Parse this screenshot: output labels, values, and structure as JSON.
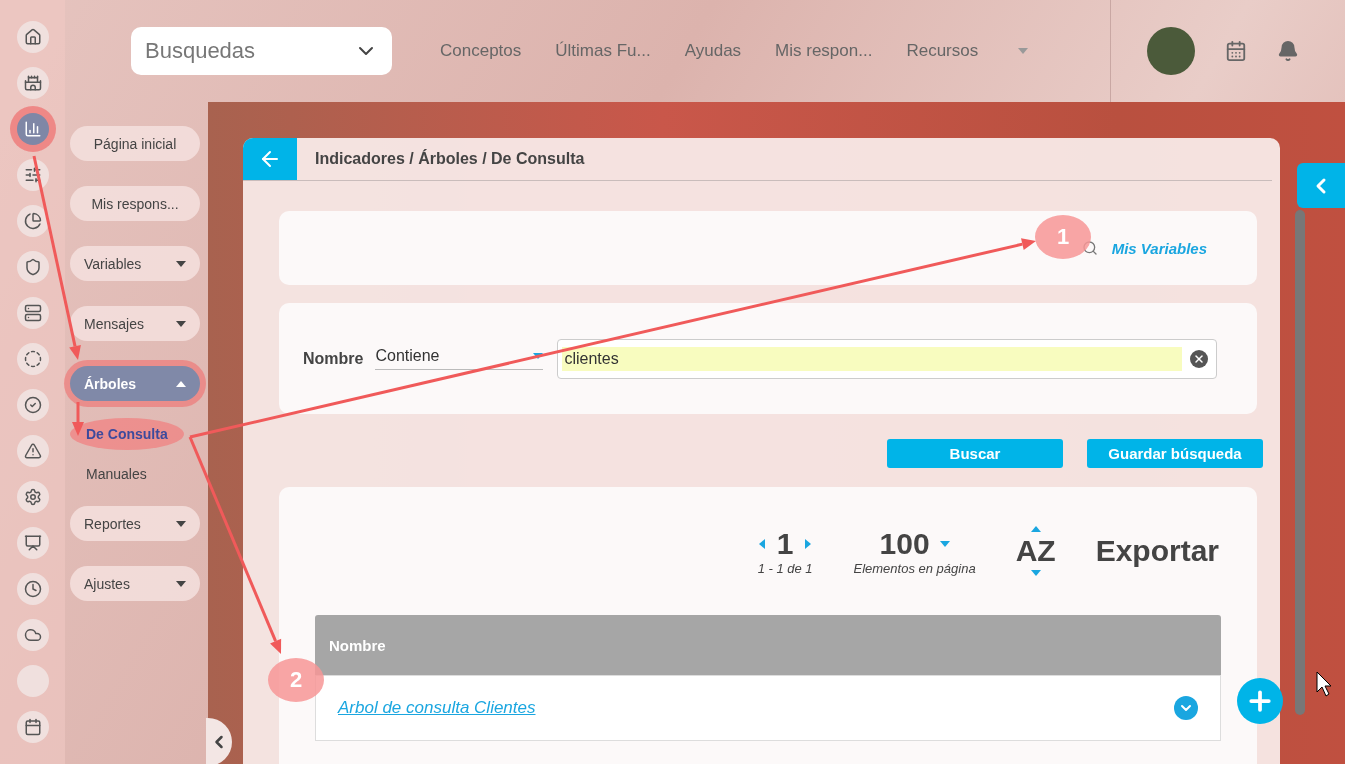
{
  "rail": [
    {
      "kind": "home",
      "selected": false
    },
    {
      "kind": "rook",
      "selected": false
    },
    {
      "kind": "chart",
      "selected": true
    },
    {
      "kind": "filter",
      "selected": false
    },
    {
      "kind": "pie",
      "selected": false
    },
    {
      "kind": "shield",
      "selected": false
    },
    {
      "kind": "list",
      "selected": false
    },
    {
      "kind": "cycle",
      "selected": false
    },
    {
      "kind": "check",
      "selected": false
    },
    {
      "kind": "alert",
      "selected": false
    },
    {
      "kind": "gears",
      "selected": false
    },
    {
      "kind": "board",
      "selected": false
    },
    {
      "kind": "clock",
      "selected": false
    },
    {
      "kind": "cloud",
      "selected": false
    },
    {
      "kind": "blank",
      "selected": false
    },
    {
      "kind": "calendar",
      "selected": false
    }
  ],
  "topbar": {
    "dropdown": "Busquedas",
    "nav": [
      "Conceptos",
      "Últimas Fu...",
      "Ayudas",
      "Mis respon...",
      "Recursos"
    ]
  },
  "menu": [
    {
      "label": "Página inicial",
      "expandable": false,
      "selected": false
    },
    {
      "label": "Mis respons...",
      "expandable": false,
      "selected": false
    },
    {
      "label": "Variables",
      "expandable": true,
      "expanded": false,
      "selected": false
    },
    {
      "label": "Mensajes",
      "expandable": true,
      "expanded": false,
      "selected": false
    },
    {
      "label": "Árboles",
      "expandable": true,
      "expanded": true,
      "selected": true,
      "children": [
        {
          "label": "De Consulta",
          "selected": true
        },
        {
          "label": "Manuales",
          "selected": false
        }
      ]
    },
    {
      "label": "Reportes",
      "expandable": true,
      "expanded": false,
      "selected": false
    },
    {
      "label": "Ajustes",
      "expandable": true,
      "expanded": false,
      "selected": false
    }
  ],
  "breadcrumb": "Indicadores / Árboles / De Consulta",
  "link": "Mis Variables",
  "filter": {
    "label": "Nombre",
    "operator": "Contiene",
    "value": "clientes"
  },
  "buttons": [
    "Buscar",
    "Guardar búsqueda"
  ],
  "pagination": {
    "page": "1",
    "range": "1 - 1 de 1",
    "page_size": "100",
    "page_size_label": "Elementos en página",
    "sort": "AZ",
    "export": "Exportar"
  },
  "table": {
    "columns": [
      "Nombre"
    ],
    "rows": [
      "Arbol de consulta Clientes"
    ]
  },
  "annotations": {
    "badges": [
      "1",
      "2"
    ]
  }
}
